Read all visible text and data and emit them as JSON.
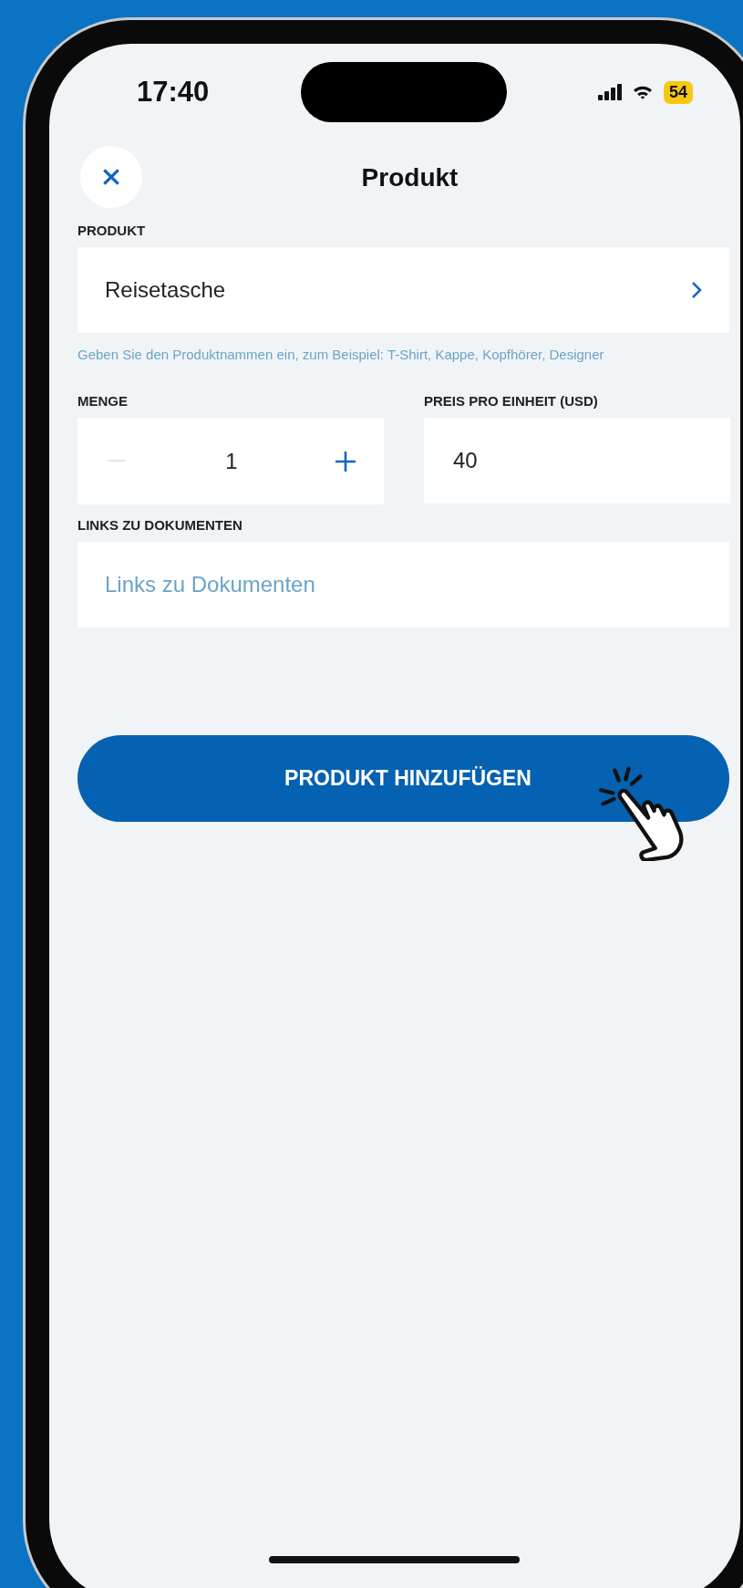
{
  "status_bar": {
    "time": "17:40",
    "battery": "54"
  },
  "header": {
    "title": "Produkt"
  },
  "product": {
    "label": "PRODUKT",
    "value": "Reisetasche",
    "hint": "Geben Sie den Produktnammen ein, zum Beispiel: T-Shirt, Kappe, Kopfhörer, Designer"
  },
  "quantity": {
    "label": "MENGE",
    "value": "1",
    "decrement_disabled": true
  },
  "price": {
    "label": "PREIS PRO EINHEIT (USD)",
    "value": "40"
  },
  "links": {
    "label": "LINKS ZU DOKUMENTEN",
    "placeholder": "Links zu Dokumenten"
  },
  "submit_button": {
    "label": "PRODUKT HINZUFÜGEN"
  }
}
